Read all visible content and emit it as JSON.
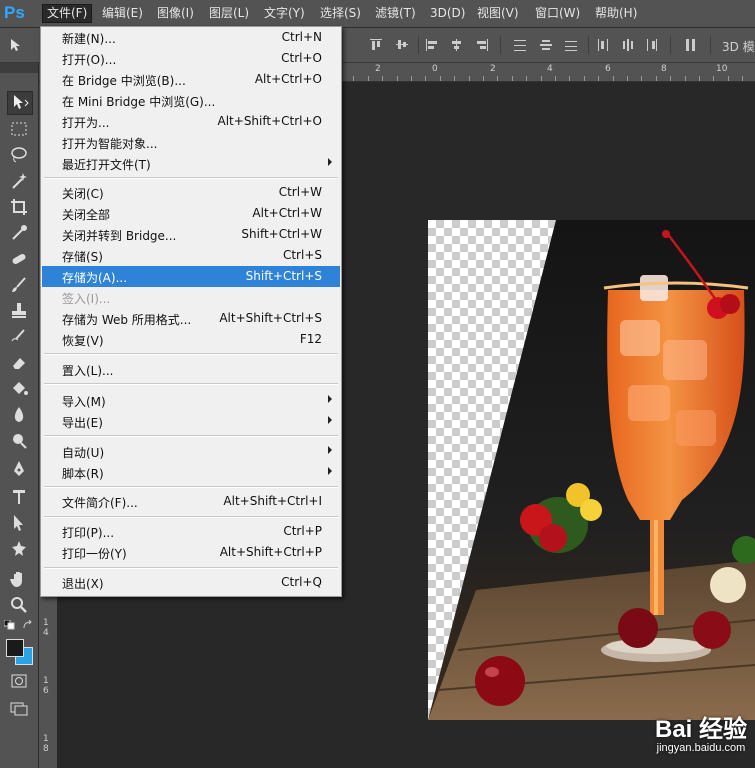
{
  "app": {
    "logo": "Ps"
  },
  "menubar": {
    "items": [
      "文件(F)",
      "编辑(E)",
      "图像(I)",
      "图层(L)",
      "文字(Y)",
      "选择(S)",
      "滤镜(T)",
      "3D(D)",
      "视图(V)",
      "窗口(W)",
      "帮助(H)"
    ],
    "active_index": 0
  },
  "options_bar": {
    "mode_label": "3D 模"
  },
  "ruler_top": {
    "labels": [
      "2",
      "0",
      "2",
      "4",
      "6",
      "8",
      "10"
    ]
  },
  "ruler_left": {
    "labels": [
      "1",
      "4",
      "1",
      "6",
      "1",
      "8"
    ]
  },
  "file_menu": {
    "items": [
      {
        "label": "新建(N)...",
        "shortcut": "Ctrl+N"
      },
      {
        "label": "打开(O)...",
        "shortcut": "Ctrl+O"
      },
      {
        "label": "在 Bridge 中浏览(B)...",
        "shortcut": "Alt+Ctrl+O"
      },
      {
        "label": "在 Mini Bridge 中浏览(G)...",
        "shortcut": ""
      },
      {
        "label": "打开为...",
        "shortcut": "Alt+Shift+Ctrl+O"
      },
      {
        "label": "打开为智能对象...",
        "shortcut": ""
      },
      {
        "label": "最近打开文件(T)",
        "shortcut": "",
        "submenu": true
      },
      {
        "label": "关闭(C)",
        "shortcut": "Ctrl+W"
      },
      {
        "label": "关闭全部",
        "shortcut": "Alt+Ctrl+W"
      },
      {
        "label": "关闭并转到 Bridge...",
        "shortcut": "Shift+Ctrl+W"
      },
      {
        "label": "存储(S)",
        "shortcut": "Ctrl+S"
      },
      {
        "label": "存储为(A)...",
        "shortcut": "Shift+Ctrl+S",
        "highlight": true
      },
      {
        "label": "签入(I)...",
        "shortcut": "",
        "disabled": true
      },
      {
        "label": "存储为 Web 所用格式...",
        "shortcut": "Alt+Shift+Ctrl+S"
      },
      {
        "label": "恢复(V)",
        "shortcut": "F12"
      },
      {
        "label": "置入(L)...",
        "shortcut": ""
      },
      {
        "label": "导入(M)",
        "shortcut": "",
        "submenu": true
      },
      {
        "label": "导出(E)",
        "shortcut": "",
        "submenu": true
      },
      {
        "label": "自动(U)",
        "shortcut": "",
        "submenu": true
      },
      {
        "label": "脚本(R)",
        "shortcut": "",
        "submenu": true
      },
      {
        "label": "文件简介(F)...",
        "shortcut": "Alt+Shift+Ctrl+I"
      },
      {
        "label": "打印(P)...",
        "shortcut": "Ctrl+P"
      },
      {
        "label": "打印一份(Y)",
        "shortcut": "Alt+Shift+Ctrl+P"
      },
      {
        "label": "退出(X)",
        "shortcut": "Ctrl+Q"
      }
    ]
  },
  "watermark": {
    "brand": "Bai 经验",
    "url": "jingyan.baidu.com"
  },
  "colors": {
    "accent": "#2e83d8",
    "foreground_swatch": "#1a1a1a",
    "background_swatch": "#28a3e8"
  }
}
